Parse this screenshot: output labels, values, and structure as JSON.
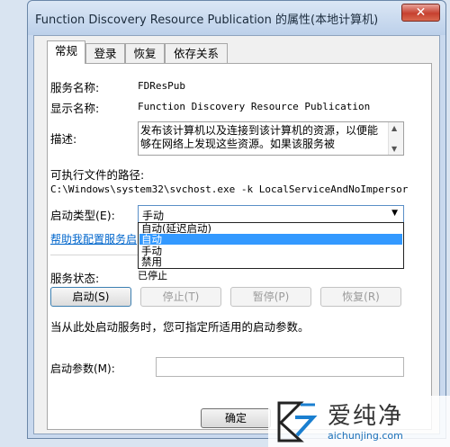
{
  "window": {
    "title": "Function Discovery Resource Publication 的属性(本地计算机)",
    "close_label": "✕"
  },
  "tabs": [
    "常规",
    "登录",
    "恢复",
    "依存关系"
  ],
  "general": {
    "service_name_label": "服务名称:",
    "service_name_value": "FDResPub",
    "display_name_label": "显示名称:",
    "display_name_value": "Function Discovery Resource Publication",
    "description_label": "描述:",
    "description_value": "发布该计算机以及连接到该计算机的资源，以便能够在网络上发现这些资源。如果该服务被",
    "exe_path_label": "可执行文件的路径:",
    "exe_path_value": "C:\\Windows\\system32\\svchost.exe -k LocalServiceAndNoImpersor",
    "startup_type_label": "启动类型(E):",
    "startup_type_value": "手动",
    "startup_options": [
      "自动(延迟启动)",
      "自动",
      "手动",
      "禁用"
    ],
    "selected_option_index": 1,
    "help_link": "帮助我配置服务启",
    "service_status_label": "服务状态:",
    "service_status_value": "已停止",
    "buttons": {
      "start": "启动(S)",
      "stop": "停止(T)",
      "pause": "暂停(P)",
      "resume": "恢复(R)"
    },
    "start_params_hint": "当从此处启动服务时，您可指定所适用的启动参数。",
    "start_params_label": "启动参数(M):",
    "start_params_value": ""
  },
  "footer": {
    "ok": "确定"
  },
  "watermark": {
    "brand": "爱纯净",
    "url": "aichunjing.com"
  }
}
